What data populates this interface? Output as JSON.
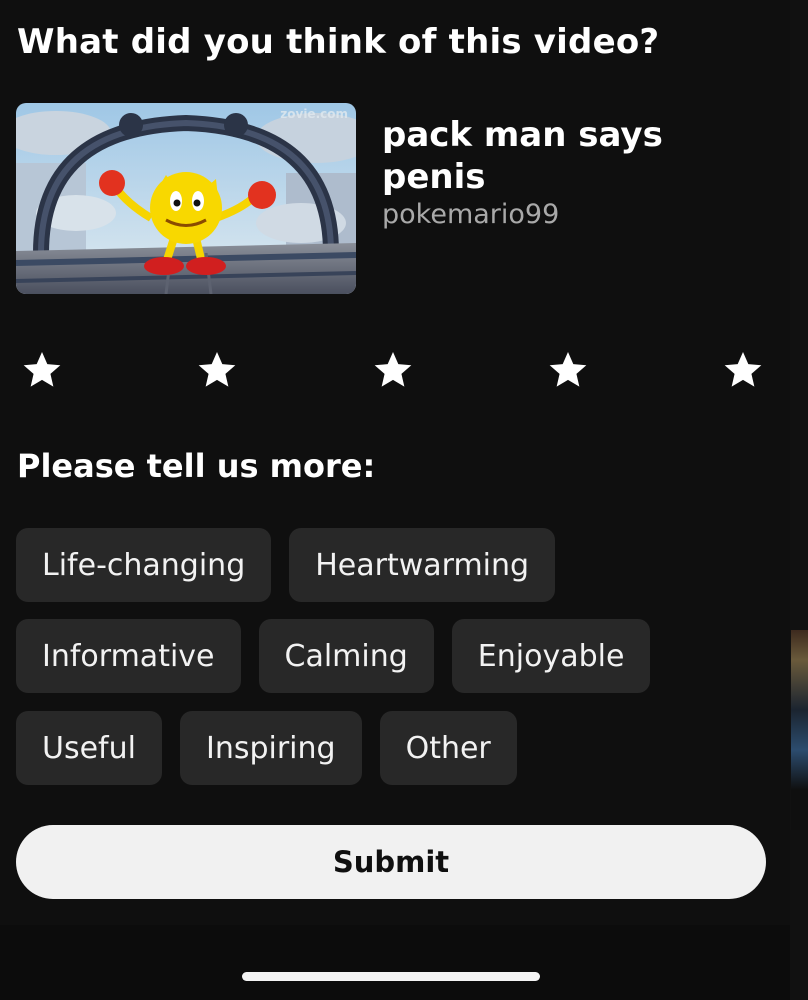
{
  "prompt": {
    "title": "What did you think of this video?"
  },
  "video": {
    "title": "pack man says penis",
    "channel": "pokemario99",
    "thumbnail_watermark": "zovie.com",
    "thumbnail_icon": "video-thumbnail"
  },
  "rating": {
    "max": 5,
    "selected": 0,
    "star_icon": "star-icon",
    "star_color": "#ffffff"
  },
  "more": {
    "heading": "Please tell us more:",
    "rows": [
      [
        "Life-changing",
        "Heartwarming"
      ],
      [
        "Informative",
        "Calming",
        "Enjoyable"
      ],
      [
        "Useful",
        "Inspiring",
        "Other"
      ]
    ]
  },
  "actions": {
    "submit_label": "Submit"
  },
  "colors": {
    "background": "#0f0f0f",
    "chip": "#282828",
    "submit_bg": "#f1f1f1",
    "secondary_text": "#a9a9a9"
  }
}
